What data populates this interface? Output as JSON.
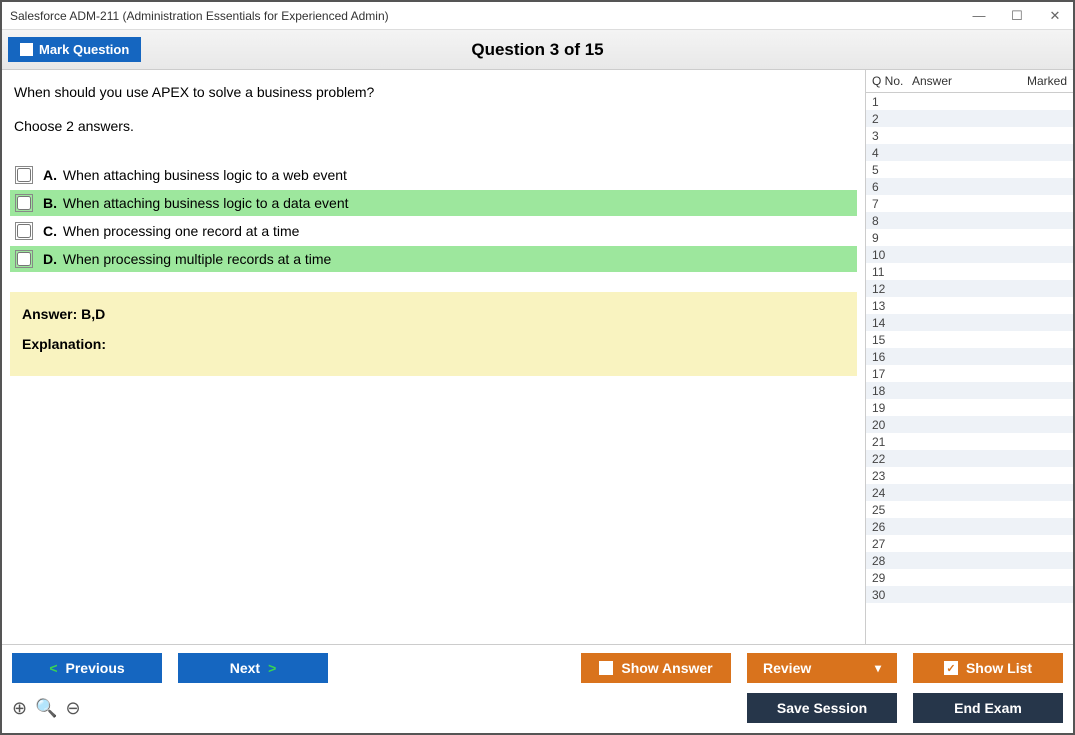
{
  "window": {
    "title": "Salesforce ADM-211 (Administration Essentials for Experienced Admin)"
  },
  "header": {
    "mark_label": "Mark Question",
    "question_title": "Question 3 of 15"
  },
  "question": {
    "prompt": "When should you use APEX to solve a business problem?",
    "instruction": "Choose 2 answers.",
    "options": [
      {
        "letter": "A.",
        "text": "When attaching business logic to a web event",
        "correct": false
      },
      {
        "letter": "B.",
        "text": "When attaching business logic to a data event",
        "correct": true
      },
      {
        "letter": "C.",
        "text": "When processing one record at a time",
        "correct": false
      },
      {
        "letter": "D.",
        "text": "When processing multiple records at a time",
        "correct": true
      }
    ]
  },
  "answer_panel": {
    "answer_label": "Answer: B,D",
    "explanation_label": "Explanation:"
  },
  "side": {
    "col_qno": "Q No.",
    "col_answer": "Answer",
    "col_marked": "Marked",
    "rows": 30
  },
  "footer": {
    "previous": "Previous",
    "next": "Next",
    "show_answer": "Show Answer",
    "review": "Review",
    "show_list": "Show List",
    "save_session": "Save Session",
    "end_exam": "End Exam"
  }
}
